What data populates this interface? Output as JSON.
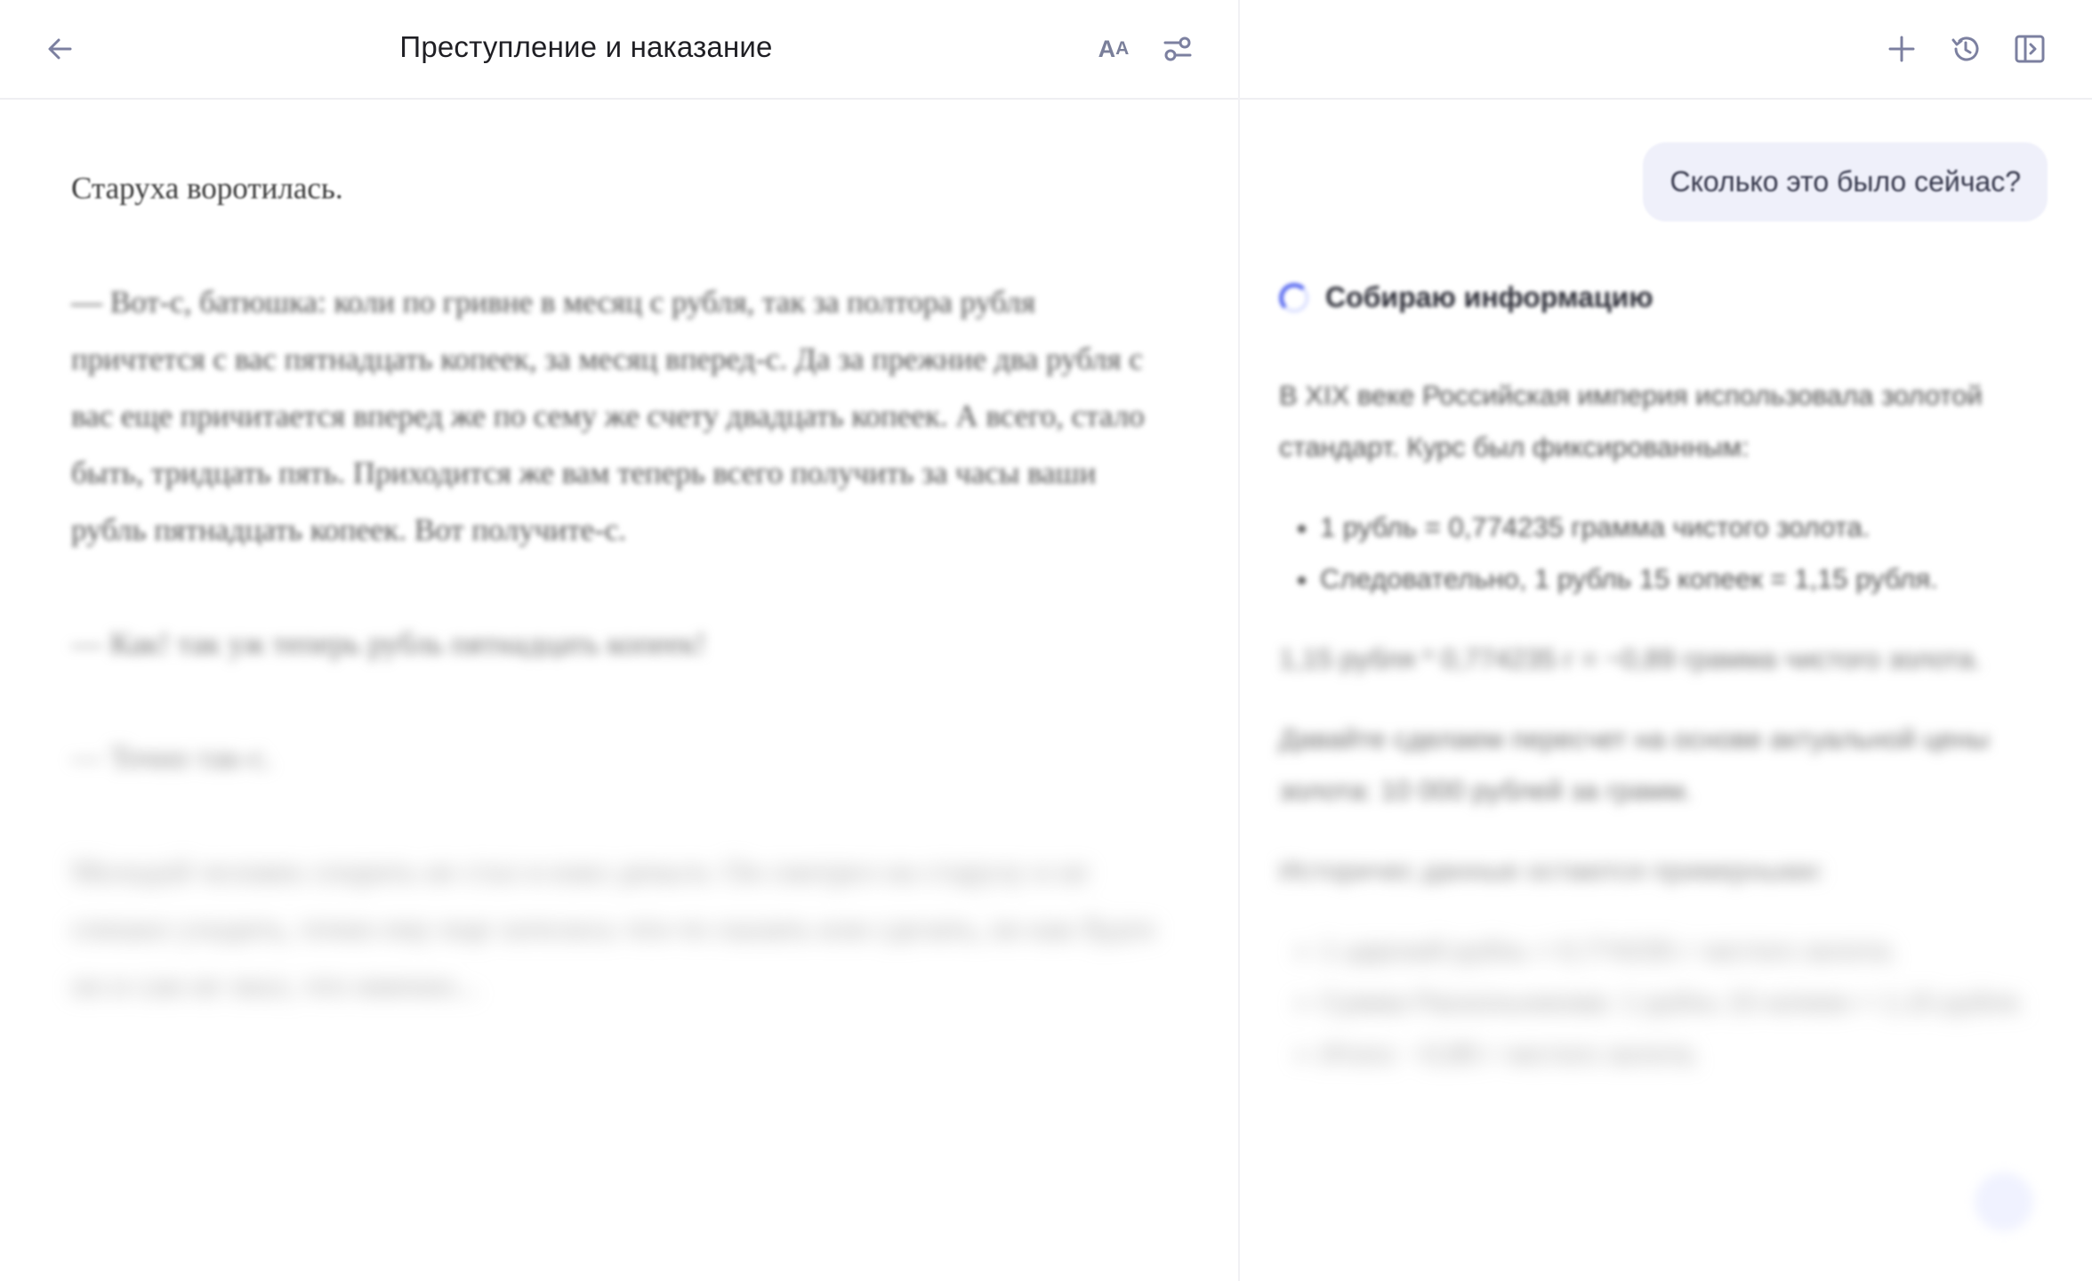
{
  "reader": {
    "title": "Преступление и наказание",
    "font_button": {
      "big": "A",
      "small": "A"
    },
    "paragraphs": [
      "Старуха воротилась.",
      "— Вот-с, батюшка: коли по гривне в месяц с рубля, так за полтора рубля причтется с вас пятнадцать копеек, за месяц вперед-с. Да за прежние два рубля с вас еще причитается вперед же по сему же счету двадцать копеек. А всего, стало быть, тридцать пять. Приходится же вам теперь всего получить за часы ваши рубль пятнадцать копеек. Вот получите-с.",
      "— Как! так уж теперь рубль пятнадцать копеек!",
      "— Точно так-с.",
      "Молодой человек спорить не стал и взял деньги. Он смотрел на старуху и не спешил уходить, точно ему еще хотелось что-то сказать или сделать, но как будто он и сам не знал, что именно..."
    ]
  },
  "assistant": {
    "user_message": "Сколько это было сейчас?",
    "status": "Собираю информацию",
    "answer": {
      "intro": "В XIX веке Российская империя использовала золотой стандарт. Курс был фиксированным:",
      "bullets1": [
        "1 рубль = 0,774235 грамма чистого золота.",
        "Следовательно, 1 рубль 15 копеек = 1,15 рубля."
      ],
      "calc": "1,15 рубля * 0,774235 г = ~0,89 грамма чистого золота.",
      "modern": "Давайте сделаем пересчет на основе актуальной цены золота: 10 000 рублей за грамм.",
      "note": "Историчес данные остаются примерными:",
      "bullets2": [
        "1 царский рубль = 0,774235 г чистого золота.",
        "Сумма Раскольникова: 1 рубль 15 копеек = 1,15 рубля.",
        "Итого: ~0,89 г чистого золота."
      ]
    }
  }
}
